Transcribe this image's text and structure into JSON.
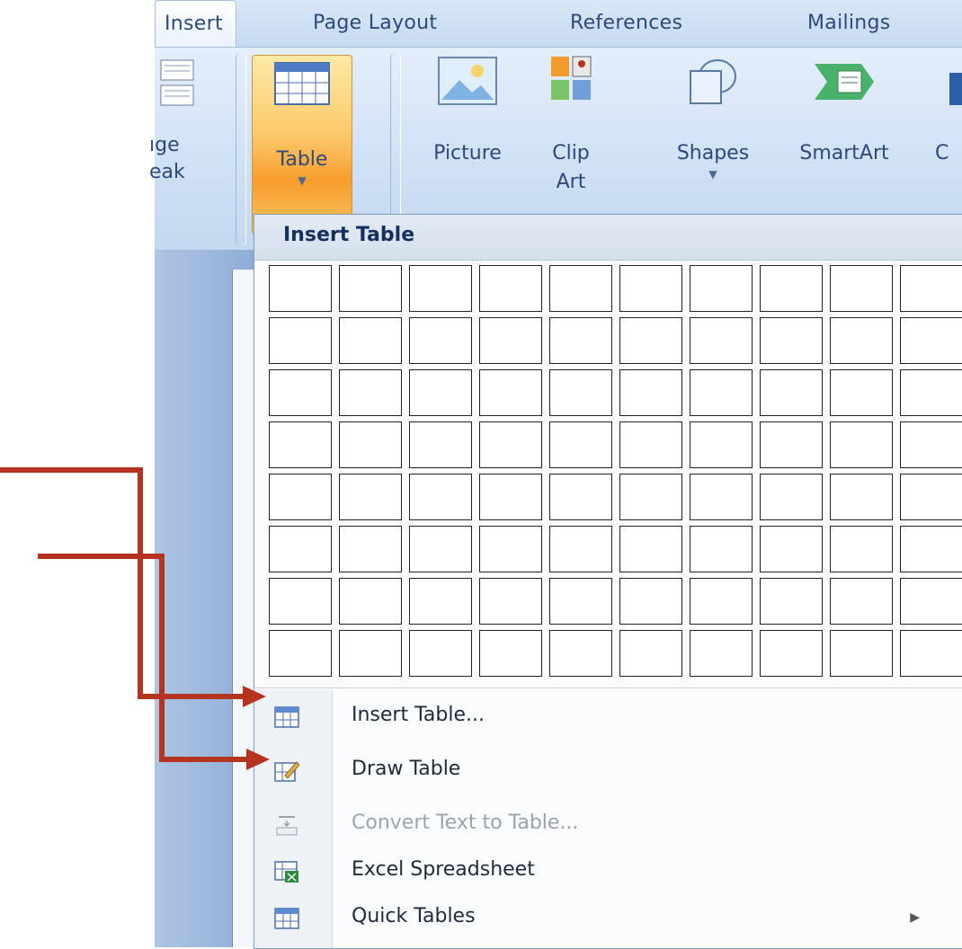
{
  "tabs": [
    "Insert",
    "Page Layout",
    "References",
    "Mailings"
  ],
  "ribbon": {
    "partial_left_label_1": "ıge",
    "partial_left_label_2": "eak",
    "table_label": "Table",
    "picture_label": "Picture",
    "clipart_label_1": "Clip",
    "clipart_label_2": "Art",
    "shapes_label": "Shapes",
    "smartart_label": "SmartArt",
    "partial_right_label": "C"
  },
  "menu": {
    "title": "Insert Table",
    "grid_rows": 8,
    "grid_cols": 10,
    "items": [
      {
        "label": "Insert Table...",
        "icon": "table-grid-icon",
        "enabled": true
      },
      {
        "label": "Draw Table",
        "icon": "pencil-table-icon",
        "enabled": true
      },
      {
        "label": "Convert Text to Table...",
        "icon": "convert-text-icon",
        "enabled": false
      },
      {
        "label": "Excel Spreadsheet",
        "icon": "excel-icon",
        "enabled": true
      },
      {
        "label": "Quick Tables",
        "icon": "quick-tables-icon",
        "enabled": true,
        "submenu": true
      }
    ]
  },
  "colors": {
    "annotation_arrow": "#b5341f",
    "highlight_orange": "#f89d2e",
    "ribbon_text": "#2b4a7a"
  }
}
